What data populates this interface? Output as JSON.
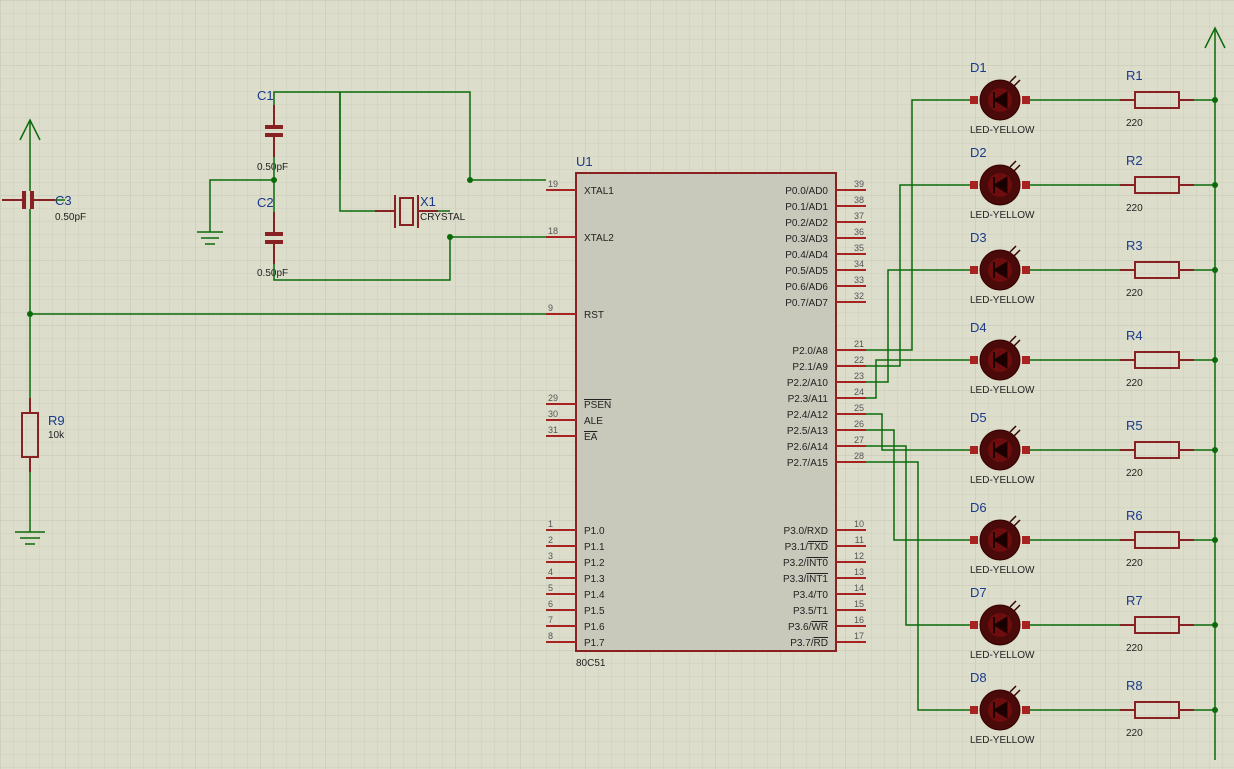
{
  "ic": {
    "ref": "U1",
    "part": "80C51",
    "left_pins_top": [
      {
        "num": "19",
        "name": "XTAL1"
      },
      {
        "num": "18",
        "name": "XTAL2"
      },
      {
        "gap": 1
      },
      {
        "num": "9",
        "name": "RST"
      }
    ],
    "left_pins_mid": [
      {
        "num": "29",
        "name": "PSEN",
        "over": true
      },
      {
        "num": "30",
        "name": "ALE"
      },
      {
        "num": "31",
        "name": "EA",
        "over": true
      }
    ],
    "left_pins_bot": [
      {
        "num": "1",
        "name": "P1.0"
      },
      {
        "num": "2",
        "name": "P1.1"
      },
      {
        "num": "3",
        "name": "P1.2"
      },
      {
        "num": "4",
        "name": "P1.3"
      },
      {
        "num": "5",
        "name": "P1.4"
      },
      {
        "num": "6",
        "name": "P1.5"
      },
      {
        "num": "7",
        "name": "P1.6"
      },
      {
        "num": "8",
        "name": "P1.7"
      }
    ],
    "right_pins_p0": [
      {
        "num": "39",
        "name": "P0.0/AD0"
      },
      {
        "num": "38",
        "name": "P0.1/AD1"
      },
      {
        "num": "37",
        "name": "P0.2/AD2"
      },
      {
        "num": "36",
        "name": "P0.3/AD3"
      },
      {
        "num": "35",
        "name": "P0.4/AD4"
      },
      {
        "num": "34",
        "name": "P0.5/AD5"
      },
      {
        "num": "33",
        "name": "P0.6/AD6"
      },
      {
        "num": "32",
        "name": "P0.7/AD7"
      }
    ],
    "right_pins_p2": [
      {
        "num": "21",
        "name": "P2.0/A8"
      },
      {
        "num": "22",
        "name": "P2.1/A9"
      },
      {
        "num": "23",
        "name": "P2.2/A10"
      },
      {
        "num": "24",
        "name": "P2.3/A11"
      },
      {
        "num": "25",
        "name": "P2.4/A12"
      },
      {
        "num": "26",
        "name": "P2.5/A13"
      },
      {
        "num": "27",
        "name": "P2.6/A14"
      },
      {
        "num": "28",
        "name": "P2.7/A15"
      }
    ],
    "right_pins_p3": [
      {
        "num": "10",
        "name": "P3.0/RXD"
      },
      {
        "num": "11",
        "name": "P3.1/TXD",
        "over_part": "TXD"
      },
      {
        "num": "12",
        "name": "P3.2/INT0",
        "over_part": "INT0"
      },
      {
        "num": "13",
        "name": "P3.3/INT1",
        "over_part": "INT1"
      },
      {
        "num": "14",
        "name": "P3.4/T0"
      },
      {
        "num": "15",
        "name": "P3.5/T1"
      },
      {
        "num": "16",
        "name": "P3.6/WR",
        "over_part": "WR"
      },
      {
        "num": "17",
        "name": "P3.7/RD",
        "over_part": "RD"
      }
    ]
  },
  "caps": [
    {
      "ref": "C1",
      "val": "0.50pF"
    },
    {
      "ref": "C2",
      "val": "0.50pF"
    },
    {
      "ref": "C3",
      "val": "0.50pF"
    }
  ],
  "crystal": {
    "ref": "X1",
    "val": "CRYSTAL"
  },
  "r9": {
    "ref": "R9",
    "val": "10k"
  },
  "leds": [
    {
      "ref": "D1",
      "val": "LED-YELLOW"
    },
    {
      "ref": "D2",
      "val": "LED-YELLOW"
    },
    {
      "ref": "D3",
      "val": "LED-YELLOW"
    },
    {
      "ref": "D4",
      "val": "LED-YELLOW"
    },
    {
      "ref": "D5",
      "val": "LED-YELLOW"
    },
    {
      "ref": "D6",
      "val": "LED-YELLOW"
    },
    {
      "ref": "D7",
      "val": "LED-YELLOW"
    },
    {
      "ref": "D8",
      "val": "LED-YELLOW"
    }
  ],
  "resistors": [
    {
      "ref": "R1",
      "val": "220"
    },
    {
      "ref": "R2",
      "val": "220"
    },
    {
      "ref": "R3",
      "val": "220"
    },
    {
      "ref": "R4",
      "val": "220"
    },
    {
      "ref": "R5",
      "val": "220"
    },
    {
      "ref": "R6",
      "val": "220"
    },
    {
      "ref": "R7",
      "val": "220"
    },
    {
      "ref": "R8",
      "val": "220"
    }
  ]
}
